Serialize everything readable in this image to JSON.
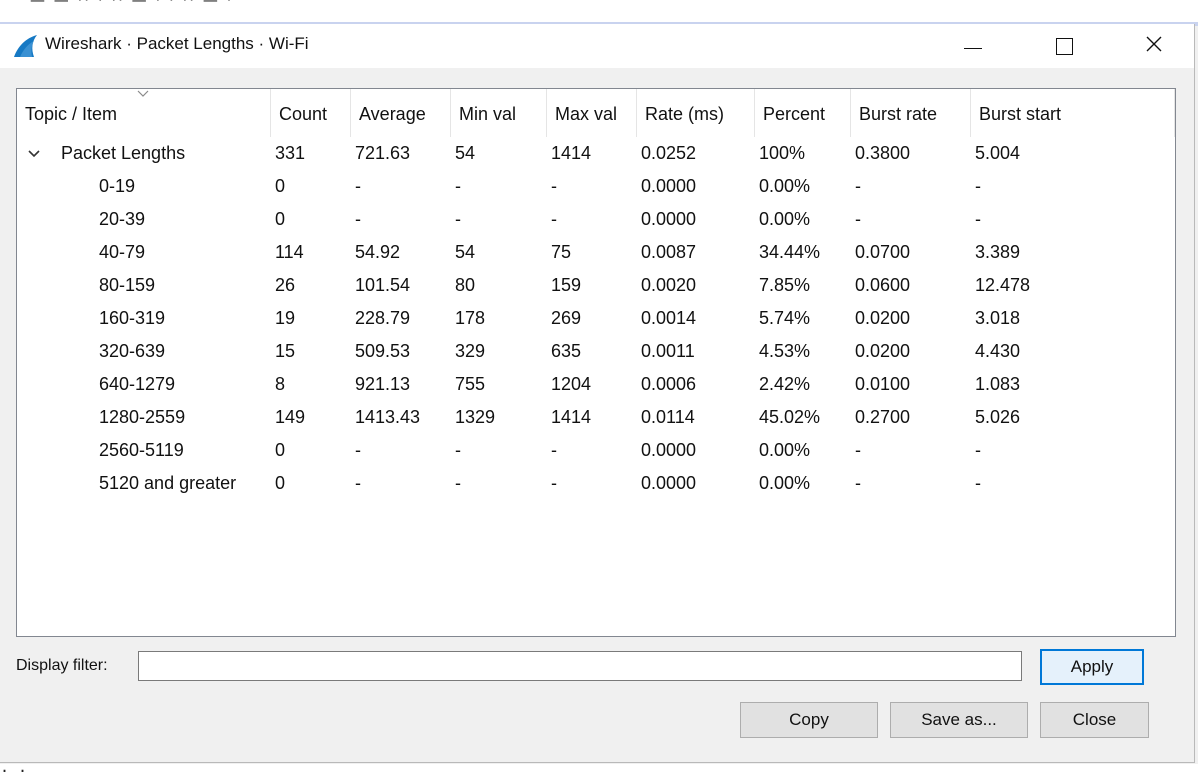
{
  "window": {
    "title": "Wireshark · Packet Lengths · Wi-Fi"
  },
  "tree": {
    "columns": [
      "Topic / Item",
      "Count",
      "Average",
      "Min val",
      "Max val",
      "Rate (ms)",
      "Percent",
      "Burst rate",
      "Burst start"
    ],
    "rows": [
      {
        "item": "Packet Lengths",
        "count": "331",
        "average": "721.63",
        "min": "54",
        "max": "1414",
        "rate": "0.0252",
        "percent": "100%",
        "burst_rate": "0.3800",
        "burst_start": "5.004"
      },
      {
        "item": "0-19",
        "count": "0",
        "average": "-",
        "min": "-",
        "max": "-",
        "rate": "0.0000",
        "percent": "0.00%",
        "burst_rate": "-",
        "burst_start": "-"
      },
      {
        "item": "20-39",
        "count": "0",
        "average": "-",
        "min": "-",
        "max": "-",
        "rate": "0.0000",
        "percent": "0.00%",
        "burst_rate": "-",
        "burst_start": "-"
      },
      {
        "item": "40-79",
        "count": "114",
        "average": "54.92",
        "min": "54",
        "max": "75",
        "rate": "0.0087",
        "percent": "34.44%",
        "burst_rate": "0.0700",
        "burst_start": "3.389"
      },
      {
        "item": "80-159",
        "count": "26",
        "average": "101.54",
        "min": "80",
        "max": "159",
        "rate": "0.0020",
        "percent": "7.85%",
        "burst_rate": "0.0600",
        "burst_start": "12.478"
      },
      {
        "item": "160-319",
        "count": "19",
        "average": "228.79",
        "min": "178",
        "max": "269",
        "rate": "0.0014",
        "percent": "5.74%",
        "burst_rate": "0.0200",
        "burst_start": "3.018"
      },
      {
        "item": "320-639",
        "count": "15",
        "average": "509.53",
        "min": "329",
        "max": "635",
        "rate": "0.0011",
        "percent": "4.53%",
        "burst_rate": "0.0200",
        "burst_start": "4.430"
      },
      {
        "item": "640-1279",
        "count": "8",
        "average": "921.13",
        "min": "755",
        "max": "1204",
        "rate": "0.0006",
        "percent": "2.42%",
        "burst_rate": "0.0100",
        "burst_start": "1.083"
      },
      {
        "item": "1280-2559",
        "count": "149",
        "average": "1413.43",
        "min": "1329",
        "max": "1414",
        "rate": "0.0114",
        "percent": "45.02%",
        "burst_rate": "0.2700",
        "burst_start": "5.026"
      },
      {
        "item": "2560-5119",
        "count": "0",
        "average": "-",
        "min": "-",
        "max": "-",
        "rate": "0.0000",
        "percent": "0.00%",
        "burst_rate": "-",
        "burst_start": "-"
      },
      {
        "item": "5120 and greater",
        "count": "0",
        "average": "-",
        "min": "-",
        "max": "-",
        "rate": "0.0000",
        "percent": "0.00%",
        "burst_rate": "-",
        "burst_start": "-"
      }
    ]
  },
  "filter": {
    "label": "Display filter:",
    "value": "",
    "placeholder": ""
  },
  "buttons": {
    "apply": "Apply",
    "copy": "Copy",
    "save_as": "Save as...",
    "close": "Close"
  },
  "icons": {
    "app": "wireshark-fin-icon",
    "expander": "chevron-down-icon",
    "sort": "sort-caret-icon",
    "minimize": "minimize-icon",
    "maximize": "maximize-icon",
    "close": "close-icon"
  },
  "colors": {
    "accent": "#0078d7",
    "app_icon": "#1679c4"
  }
}
